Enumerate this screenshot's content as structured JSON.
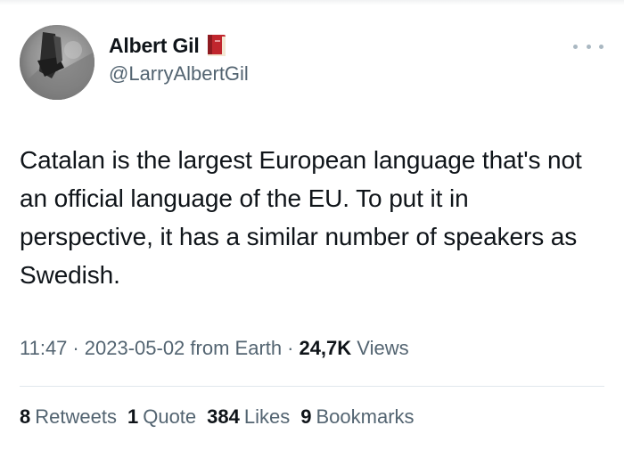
{
  "author": {
    "display_name": "Albert Gil",
    "handle": "@LarryAlbertGil",
    "badge_icon": "red-book-icon"
  },
  "more_icon": "more-dots-icon",
  "tweet": {
    "text": "Catalan is the largest European language that's not an official language of the EU. To put it in perspective, it has a similar number of speakers as Swedish."
  },
  "meta": {
    "time": "11:47",
    "date": "2023-05-02",
    "source": "from Earth",
    "views_count": "24,7K",
    "views_label": "Views",
    "separator": "·"
  },
  "stats": [
    {
      "count": "8",
      "label": "Retweets"
    },
    {
      "count": "1",
      "label": "Quote"
    },
    {
      "count": "384",
      "label": "Likes"
    },
    {
      "count": "9",
      "label": "Bookmarks"
    }
  ],
  "colors": {
    "text_primary": "#0f1419",
    "text_secondary": "#536471",
    "divider": "#e1e8ed",
    "badge_red": "#c0262d"
  }
}
